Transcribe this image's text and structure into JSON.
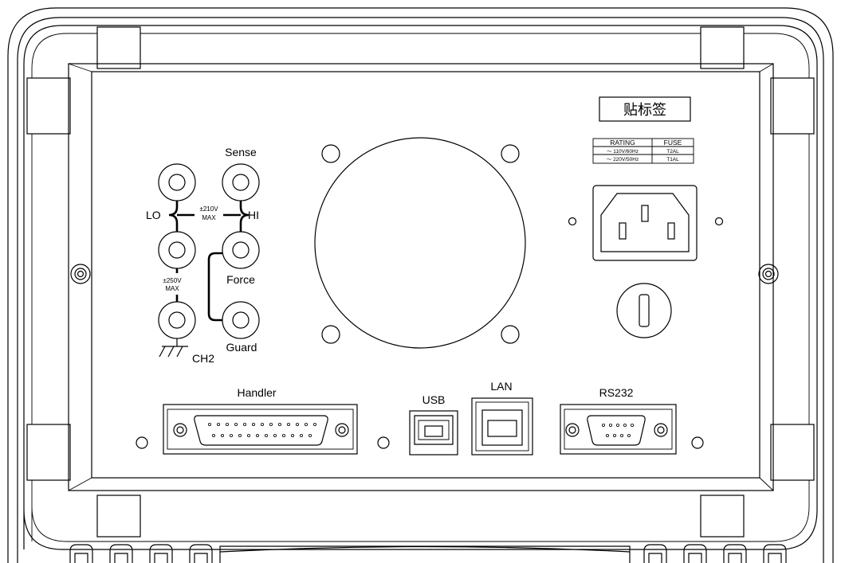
{
  "label_box": "贴标签",
  "terminals": {
    "sense": "Sense",
    "lo": "LO",
    "hi": "HI",
    "force": "Force",
    "guard": "Guard",
    "ch2": "CH2",
    "max_210": "±210V",
    "max_210_unit": "MAX",
    "max_250": "±250V",
    "max_250_unit": "MAX"
  },
  "rating_table": {
    "headers": [
      "RATING",
      "FUSE"
    ],
    "rows": [
      [
        "～ 110V/60Hz",
        "T2AL"
      ],
      [
        "～ 220V/50Hz",
        "T1AL"
      ]
    ]
  },
  "ports": {
    "handler": "Handler",
    "usb": "USB",
    "lan": "LAN",
    "rs232": "RS232"
  }
}
